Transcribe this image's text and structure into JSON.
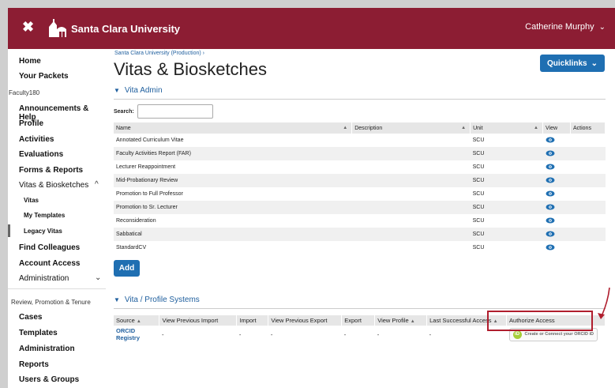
{
  "topbar": {
    "close_glyph": "✖",
    "brand": "Santa Clara University",
    "user_name": "Catherine Murphy",
    "user_chevron": "⌄",
    "bg_color": "#8c1d33"
  },
  "sidebar": {
    "home": "Home",
    "packets": "Your Packets",
    "faculty_section": "Faculty180",
    "announcements": "Announcements & Help",
    "profile": "Profile",
    "activities": "Activities",
    "evaluations": "Evaluations",
    "forms": "Forms & Reports",
    "vitas": "Vitas & Biosketches",
    "vitas_chevron": "^",
    "sub_vitas": "Vitas",
    "sub_templates": "My Templates",
    "sub_legacy": "Legacy Vitas",
    "find_colleagues": "Find Colleagues",
    "account_access": "Account Access",
    "administration": "Administration",
    "admin_chevron": "⌄",
    "rpt_section": "Review, Promotion & Tenure",
    "cases": "Cases",
    "templates": "Templates",
    "administration2": "Administration",
    "reports": "Reports",
    "users_groups": "Users & Groups"
  },
  "main": {
    "breadcrumb": "Santa Clara University (Production)  ›",
    "title": "Vitas & Biosketches",
    "quicklinks": "Quicklinks",
    "quicklinks_chevron": "⌄",
    "vita_admin_heading": "Vita Admin",
    "search_label": "Search:",
    "search_value": "",
    "vita_table": {
      "headers": [
        "Name",
        "Description",
        "Unit",
        "View",
        "Actions"
      ],
      "rows": [
        {
          "name": "Annotated Curriculum Vitae",
          "description": "",
          "unit": "SCU"
        },
        {
          "name": "Faculty Activities Report (FAR)",
          "description": "",
          "unit": "SCU"
        },
        {
          "name": "Lecturer Reappointment",
          "description": "",
          "unit": "SCU"
        },
        {
          "name": "Mid-Probationary Review",
          "description": "",
          "unit": "SCU"
        },
        {
          "name": "Promotion to Full Professor",
          "description": "",
          "unit": "SCU"
        },
        {
          "name": "Promotion to Sr. Lecturer",
          "description": "",
          "unit": "SCU"
        },
        {
          "name": "Reconsideration",
          "description": "",
          "unit": "SCU"
        },
        {
          "name": "Sabbatical",
          "description": "",
          "unit": "SCU"
        },
        {
          "name": "StandardCV",
          "description": "",
          "unit": "SCU"
        }
      ]
    },
    "add_button": "Add",
    "profile_heading": "Vita / Profile Systems",
    "profile_table": {
      "headers": [
        "Source",
        "View Previous Import",
        "Import",
        "View Previous Export",
        "Export",
        "View Profile",
        "Last Successful Access",
        "Authorize Access"
      ],
      "row": {
        "source": "ORCID Registry",
        "view_prev_import": "-",
        "import": "-",
        "view_prev_export": "-",
        "export": "-",
        "view_profile": "-",
        "last_access": "-",
        "authorize": "Create or Connect your ORCID iD",
        "orcid_logo": "iD"
      }
    }
  },
  "colors": {
    "accent": "#1f6fb2",
    "link": "#1f5f9e",
    "highlight": "#b01e2e",
    "orcid": "#a6ce39"
  }
}
